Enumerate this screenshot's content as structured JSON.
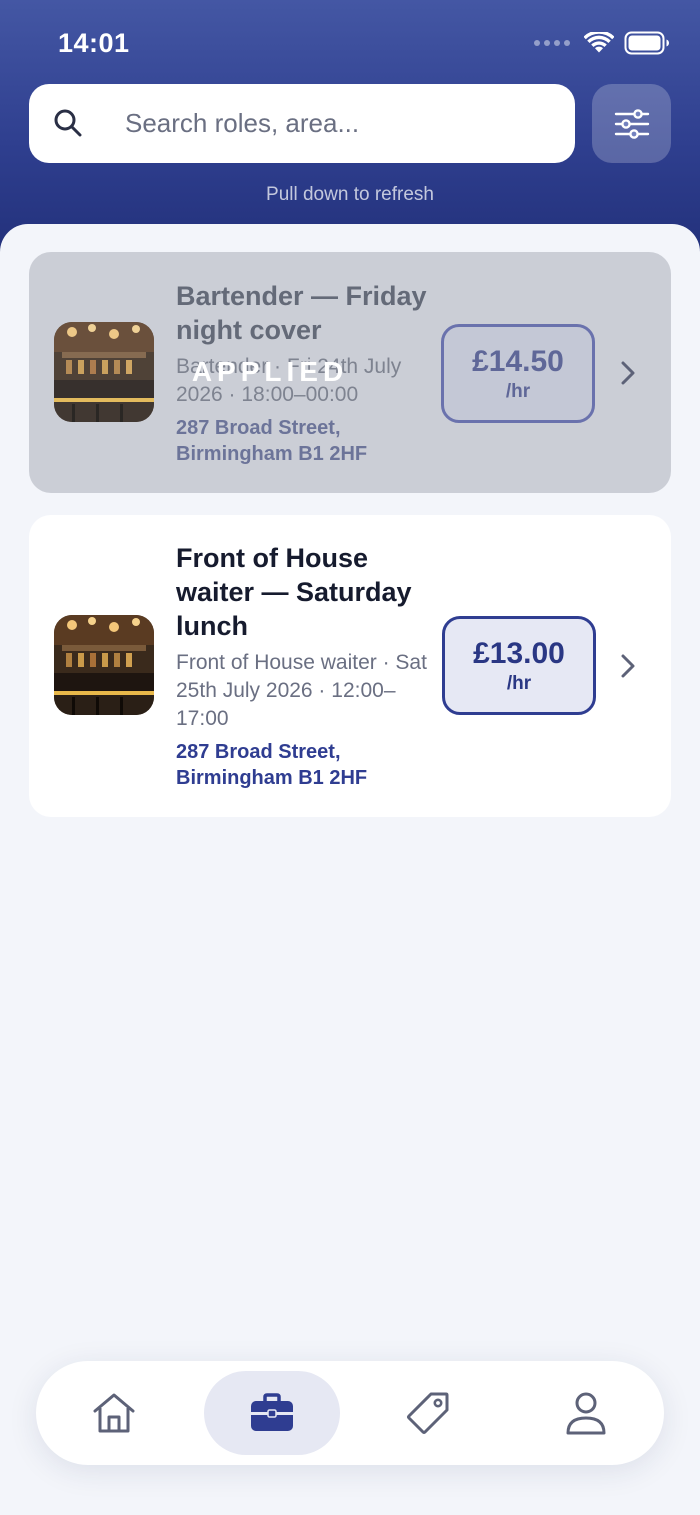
{
  "status_bar": {
    "time": "14:01"
  },
  "search": {
    "placeholder": "Search roles, area..."
  },
  "refresh_hint": "Pull down to refresh",
  "jobs": [
    {
      "title": "Bartender — Friday night cover",
      "meta": "Bartender · Fri 24th July 2026 · 18:00–00:00",
      "address": "287 Broad Street, Birmingham B1 2HF",
      "rate": "£14.50",
      "rate_unit": "/hr",
      "status": "APPLIED"
    },
    {
      "title": "Front of House waiter — Saturday lunch",
      "meta": "Front of House waiter · Sat 25th July 2026 · 12:00–17:00",
      "address": "287 Broad Street, Birmingham B1 2HF",
      "rate": "£13.00",
      "rate_unit": "/hr"
    }
  ],
  "nav": {
    "items": [
      {
        "icon": "home-icon"
      },
      {
        "icon": "briefcase-icon",
        "active": true
      },
      {
        "icon": "tag-icon"
      },
      {
        "icon": "user-icon"
      }
    ]
  },
  "colors": {
    "primary": "#2f3d91",
    "header_top": "#4457a4",
    "header_bottom": "#22307a",
    "background": "#f3f5fa",
    "applied_card": "#cbced6"
  }
}
